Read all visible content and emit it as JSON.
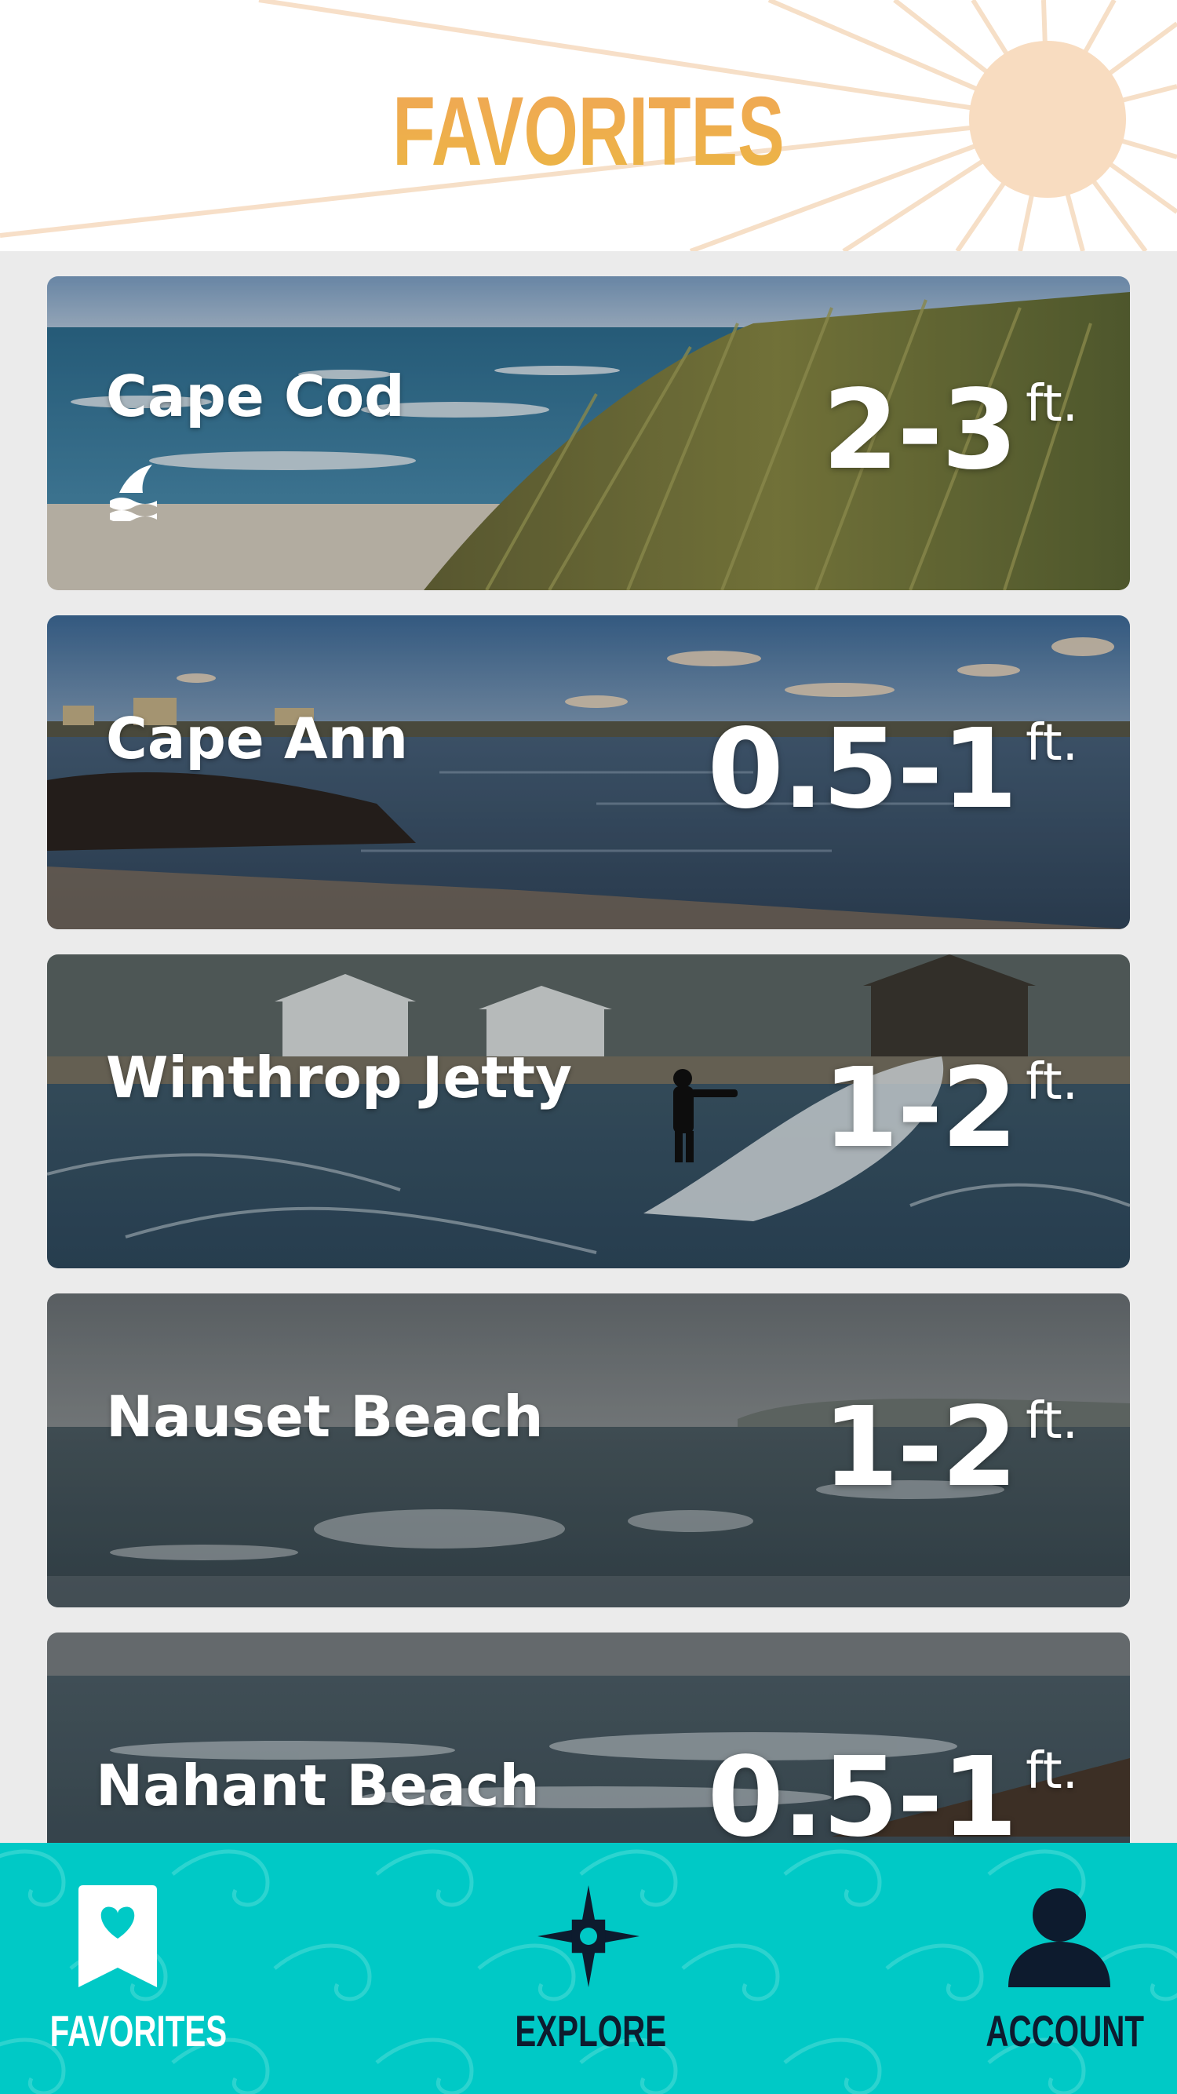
{
  "header": {
    "title": "FAVORITES"
  },
  "spots": [
    {
      "name": "Cape Cod",
      "height": "2-3",
      "unit": "ft.",
      "shark_alert": true
    },
    {
      "name": "Cape Ann",
      "height": "0.5-1",
      "unit": "ft.",
      "shark_alert": false
    },
    {
      "name": "Winthrop Jetty",
      "height": "1-2",
      "unit": "ft.",
      "shark_alert": false
    },
    {
      "name": "Nauset Beach",
      "height": "1-2",
      "unit": "ft.",
      "shark_alert": false
    },
    {
      "name": "Nahant Beach",
      "height": "0.5-1",
      "unit": "ft.",
      "shark_alert": false
    }
  ],
  "nav": {
    "favorites": {
      "label": "FAVORITES",
      "icon": "heart-bookmark-icon",
      "active": true
    },
    "explore": {
      "label": "EXPLORE",
      "icon": "compass-icon",
      "active": false
    },
    "account": {
      "label": "ACCOUNT",
      "icon": "person-icon",
      "active": false
    }
  },
  "colors": {
    "title_gradient_top": "#f0a558",
    "title_gradient_bottom": "#e8b842",
    "nav_background": "#00c9c6",
    "nav_active": "#ffffff",
    "nav_inactive": "#0d1b2e",
    "sun": "#f8dcc0"
  }
}
